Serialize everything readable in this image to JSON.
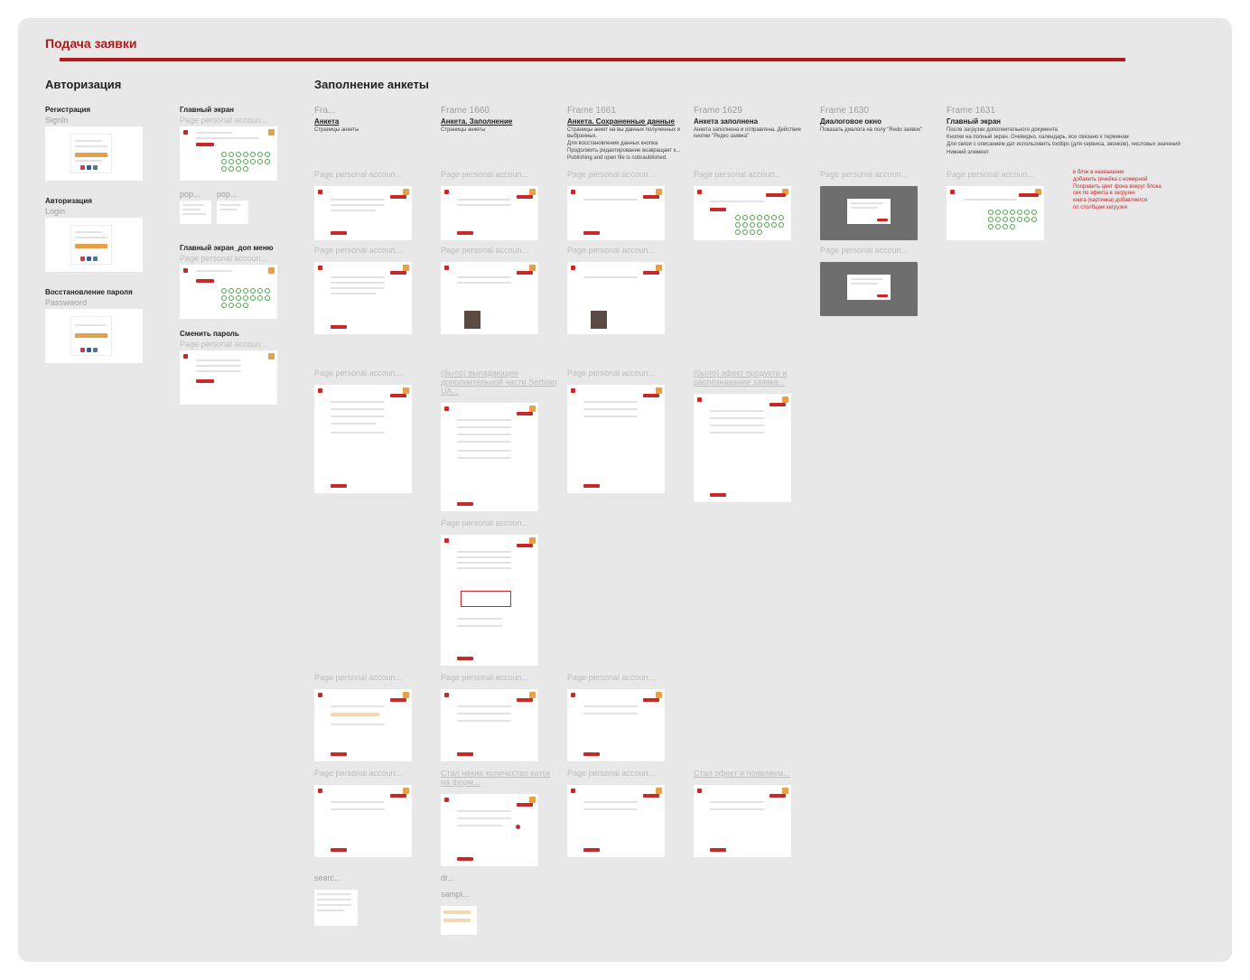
{
  "section": "Подача заявки",
  "groups": {
    "auth": "Авторизация",
    "fill": "Заполнение анкеты"
  },
  "auth_cols": {
    "reg": "Регистрация",
    "signin": "SignIn",
    "login_t": "Авторизация",
    "login": "Login",
    "restore_t": "Восстановление пароля",
    "password": "Passwword",
    "main_t": "Главный экран",
    "ppa": "Page personal accoun...",
    "pop1": "pop...",
    "pop2": "pop...",
    "main2_t": "Главный экран_доп меню",
    "chpw_t": "Сменить пароль"
  },
  "frames": {
    "f59": "Fra...",
    "f60": "Frame 1660",
    "f61": "Frame 1661",
    "f29": "Frame 1629",
    "f30": "Frame 1630",
    "f31": "Frame 1631"
  },
  "fill_cols": {
    "c1": "Анкета",
    "c1s": "Страницы анкеты",
    "c2": "Анкета. Заполнение",
    "c2s": "Страницы анкеты",
    "c3": "Анкета. Сохраненные данные",
    "c3s1": "Страницы анкет на вы данных полученных и выбранных.",
    "c3s2": "Для восстановлении данных кнопка Продолжить редактирование возвращает к...",
    "c3s3": "Publishing and open file is nobraublished.",
    "c4": "Анкета заполнена",
    "c4s": "Анкета заполнена и отправлена. Действие кнопки \"Редко заявка\"",
    "c5": "Диалоговое окно",
    "c5s": "Показать диалога на полу \"Redo заявок\"",
    "c6": "Главный экран",
    "c6s1": "После загрузки дополнительного документа",
    "c6s2": "Кнопки на полный экран. Очевидно, календарь, все связано к терминам",
    "c6s3": "Для связи с описанием дат использовить tooltips (для сервиса, звонков), числовых значений",
    "c6s4": "Нижний элемент"
  },
  "row3labels": {
    "c2": "(было) выпадающее дополнительной части Serbian UA...",
    "c4": "(было) эфект продукта и распознавание заявка..."
  },
  "row6labels": {
    "c2": "Стал некие количество каток на форм...",
    "c4": "Стал эфект и появляем..."
  },
  "annotation": {
    "l1": "в блок в названании",
    "l2": "добавить (ячейка с номерной",
    "l3": "Поправить цвет фона вокруг блока",
    "l4": "сек по эфекта в загрузке",
    "l5": "книга (картинка) добавляется",
    "l6": "по столбцам загрузки"
  },
  "bottom": {
    "search": "searc...",
    "dr": "dr...",
    "sample": "sampl..."
  },
  "ppa": "Page personal accoun..."
}
